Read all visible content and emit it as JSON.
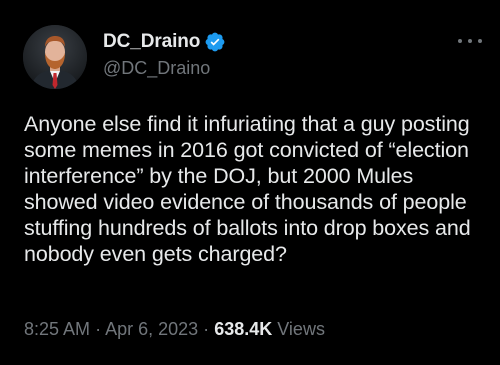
{
  "tweet": {
    "author": {
      "display_name": "DC_Draino",
      "handle": "@DC_Draino",
      "verified": true,
      "verified_color": "#1d9bf0"
    },
    "text": "Anyone else find it infuriating that a guy posting some memes in 2016 got convicted of “election interference” by the DOJ, but 2000 Mules showed video evidence of thousands of people stuffing hundreds of ballots into drop boxes and nobody even gets charged?",
    "time": "8:25 AM",
    "separator": "·",
    "date": "Apr 6, 2023",
    "views_count": "638.4K",
    "views_label": "Views",
    "more_icon": "more-horizontal-icon",
    "verified_icon": "verified-badge-icon"
  },
  "colors": {
    "background": "#000000",
    "primary_text": "#e7e9ea",
    "secondary_text": "#71767b",
    "accent": "#1d9bf0"
  }
}
